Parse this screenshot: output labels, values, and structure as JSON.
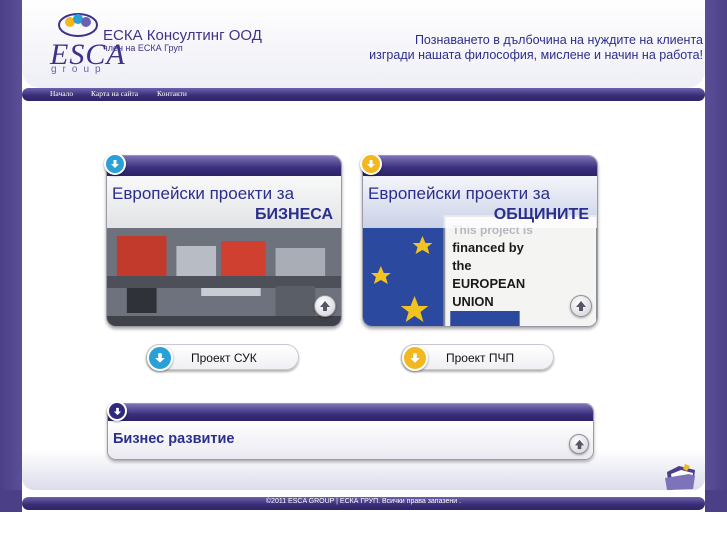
{
  "header": {
    "logo_text": "ESCA",
    "logo_subtext": "group",
    "company_name": "ЕСКА Консултинг ООД",
    "member_text": "член на ЕСКА Груп",
    "slogan_line1": "Познаването в дълбочина на нуждите на клиента",
    "slogan_line2": "изгради нашата философия, мислене и начин на работа!"
  },
  "nav": {
    "items": [
      {
        "label": "Начало"
      },
      {
        "label": "Карта на сайта"
      },
      {
        "label": "Контакти"
      }
    ]
  },
  "cards": [
    {
      "title_line1": "Европейски проекти за",
      "title_line2": "БИЗНЕСА",
      "badge_color": "#2aa0d8",
      "button_label": "Проект СУК"
    },
    {
      "title_line1": "Европейски проекти за",
      "title_line2": "ОБЩИНИТЕ",
      "badge_color": "#f2b81e",
      "button_label": "Проект ПЧП",
      "photo_text": [
        "This project is",
        "financed by",
        "the",
        "EUROPEAN",
        "UNION"
      ]
    }
  ],
  "business": {
    "label": "Бизнес развитие",
    "badge_color": "#2f2a7a"
  },
  "footer": {
    "text": "©2011 ESCA GROUP | ЕСКА ГРУП. Всички права запазени ."
  },
  "colors": {
    "brand_purple": "#4b3f88",
    "title_blue": "#2a2e8c"
  }
}
